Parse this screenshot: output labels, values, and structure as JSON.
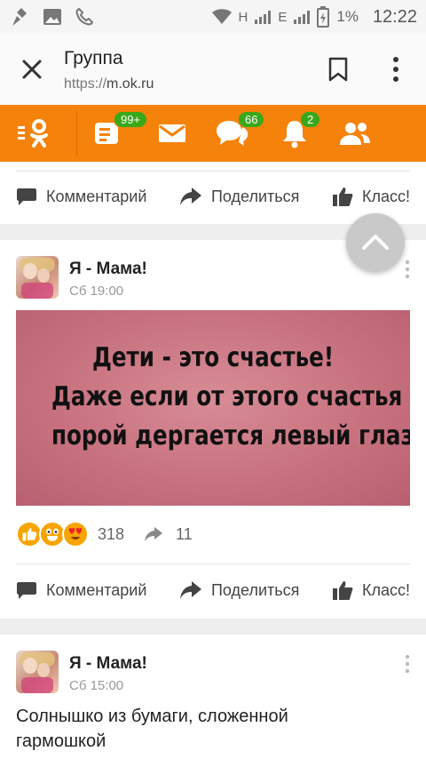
{
  "status_bar": {
    "battery_percent": "1%",
    "time": "12:22",
    "network_1": "H",
    "network_2": "E"
  },
  "browser": {
    "title": "Группа",
    "url_scheme": "https://",
    "url_host": "m.ok.ru"
  },
  "nav": {
    "feed_badge": "99+",
    "messages_badge": "66",
    "notifications_badge": "2"
  },
  "actions": {
    "comment": "Комментарий",
    "share": "Поделиться",
    "like": "Класс!"
  },
  "posts": [
    {
      "author": "Я - Мама!",
      "date": "Сб 19:00",
      "image_text": [
        "Дети - это счастье!",
        "Даже если от этого счастья",
        "порой дергается левый глаз."
      ],
      "reactions_count": "318",
      "shares_count": "11"
    },
    {
      "author": "Я - Мама!",
      "date": "Сб 15:00",
      "text_line1": "Солнышко из бумаги, сложенной",
      "text_line2": "гармошкой"
    }
  ],
  "colors": {
    "brand_orange": "#f5820a",
    "badge_green": "#39a81b"
  }
}
